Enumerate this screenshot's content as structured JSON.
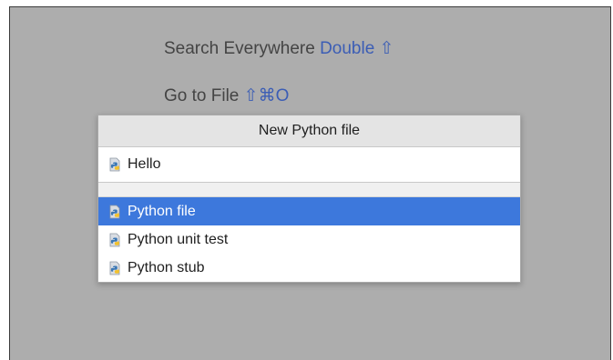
{
  "hints": {
    "search_label": "Search Everywhere",
    "search_shortcut": "Double ⇧",
    "goto_label": "Go to File",
    "goto_shortcut": "⇧⌘O"
  },
  "dialog": {
    "title": "New Python file",
    "name_value": "Hello",
    "kinds": [
      {
        "label": "Python file",
        "icon": "python-file-icon",
        "selected": true
      },
      {
        "label": "Python unit test",
        "icon": "python-file-icon",
        "selected": false
      },
      {
        "label": "Python stub",
        "icon": "python-file-icon",
        "selected": false
      }
    ]
  },
  "colors": {
    "selection": "#3d78dc",
    "shortcut": "#3b5db5",
    "backdrop": "#adadad"
  }
}
